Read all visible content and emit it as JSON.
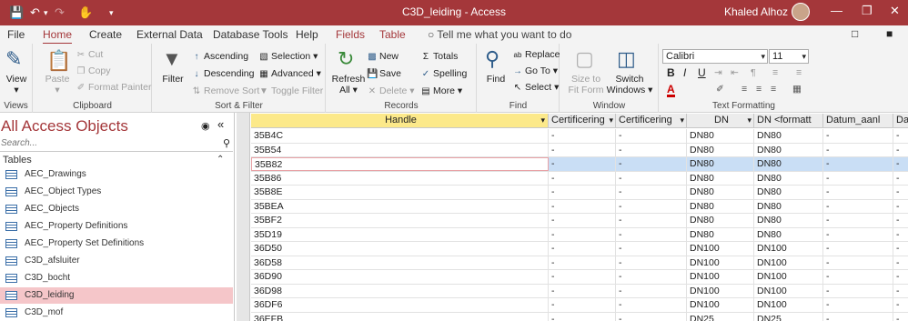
{
  "title_bar": {
    "title": "C3D_leiding  -  Access",
    "user": "Khaled Alhoz"
  },
  "tabs": [
    "File",
    "Home",
    "Create",
    "External Data",
    "Database Tools",
    "Help",
    "Fields",
    "Table"
  ],
  "active_tab": "Home",
  "tell_me": "Tell me what you want to do",
  "ribbon": {
    "views": {
      "view": "View",
      "label": "Views"
    },
    "clipboard": {
      "paste": "Paste",
      "cut": "Cut",
      "copy": "Copy",
      "format_painter": "Format Painter",
      "label": "Clipboard"
    },
    "sort_filter": {
      "filter": "Filter",
      "ascending": "Ascending",
      "descending": "Descending",
      "remove_sort": "Remove Sort",
      "selection": "Selection",
      "advanced": "Advanced",
      "toggle_filter": "Toggle Filter",
      "label": "Sort & Filter"
    },
    "records": {
      "refresh": "Refresh",
      "refresh_all": "All",
      "new": "New",
      "save": "Save",
      "delete": "Delete",
      "totals": "Totals",
      "spelling": "Spelling",
      "more": "More",
      "label": "Records"
    },
    "find": {
      "find": "Find",
      "replace": "Replace",
      "goto": "Go To",
      "select": "Select",
      "label": "Find"
    },
    "window": {
      "size_to": "Size to",
      "fit_form": "Fit Form",
      "switch": "Switch",
      "windows": "Windows",
      "label": "Window"
    },
    "text_formatting": {
      "font": "Calibri",
      "size": "11",
      "label": "Text Formatting",
      "bold": "B",
      "italic": "I",
      "underline": "U"
    }
  },
  "nav": {
    "title": "All Access Objects",
    "search_placeholder": "Search...",
    "section": "Tables",
    "items": [
      "AEC_Drawings",
      "AEC_Object Types",
      "AEC_Objects",
      "AEC_Property Definitions",
      "AEC_Property Set Definitions",
      "C3D_afsluiter",
      "C3D_bocht",
      "C3D_leiding",
      "C3D_mof"
    ],
    "selected": "C3D_leiding"
  },
  "grid": {
    "columns": [
      "Handle",
      "Certificering",
      "Certificering",
      "DN",
      "DN <formatt",
      "Datum_aanl",
      "Da"
    ],
    "rows": [
      [
        "35B4C",
        "-",
        "-",
        "DN80",
        "DN80",
        "-",
        "-"
      ],
      [
        "35B54",
        "-",
        "-",
        "DN80",
        "DN80",
        "-",
        "-"
      ],
      [
        "35B82",
        "-",
        "-",
        "DN80",
        "DN80",
        "-",
        "-"
      ],
      [
        "35B86",
        "-",
        "-",
        "DN80",
        "DN80",
        "-",
        "-"
      ],
      [
        "35B8E",
        "-",
        "-",
        "DN80",
        "DN80",
        "-",
        "-"
      ],
      [
        "35BEA",
        "-",
        "-",
        "DN80",
        "DN80",
        "-",
        "-"
      ],
      [
        "35BF2",
        "-",
        "-",
        "DN80",
        "DN80",
        "-",
        "-"
      ],
      [
        "35D19",
        "-",
        "-",
        "DN80",
        "DN80",
        "-",
        "-"
      ],
      [
        "36D50",
        "-",
        "-",
        "DN100",
        "DN100",
        "-",
        "-"
      ],
      [
        "36D58",
        "-",
        "-",
        "DN100",
        "DN100",
        "-",
        "-"
      ],
      [
        "36D90",
        "-",
        "-",
        "DN100",
        "DN100",
        "-",
        "-"
      ],
      [
        "36D98",
        "-",
        "-",
        "DN100",
        "DN100",
        "-",
        "-"
      ],
      [
        "36DF6",
        "-",
        "-",
        "DN100",
        "DN100",
        "-",
        "-"
      ],
      [
        "36EFB",
        "-",
        "-",
        "DN25",
        "DN25",
        "-",
        "-"
      ]
    ],
    "selected_row": 2
  }
}
